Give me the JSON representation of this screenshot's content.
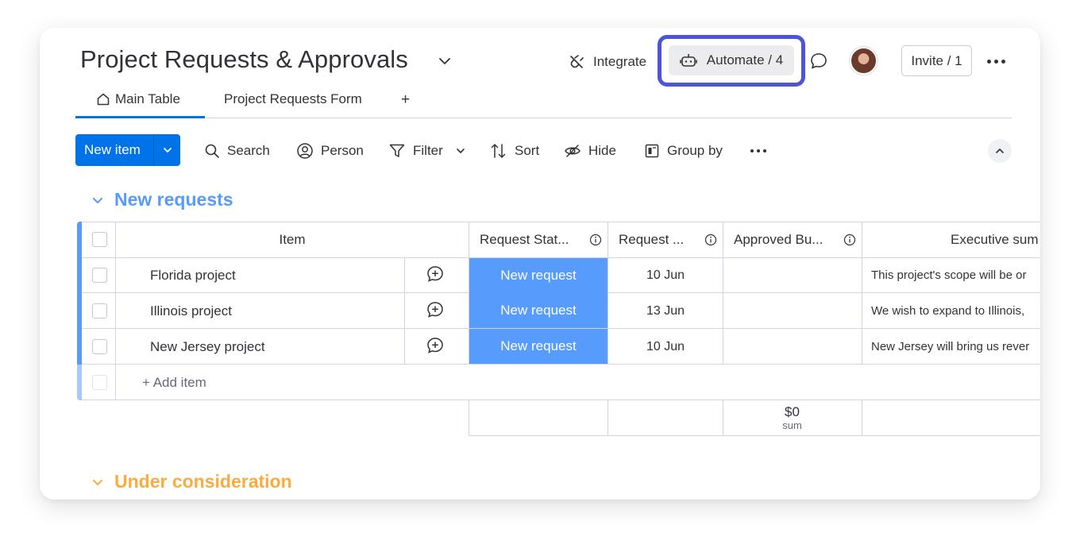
{
  "board": {
    "title": "Project Requests & Approvals",
    "integrate_label": "Integrate",
    "automate_label": "Automate / 4",
    "invite_label": "Invite / 1"
  },
  "tabs": [
    {
      "label": "Main Table",
      "icon": "home-icon",
      "active": true
    },
    {
      "label": "Project Requests Form",
      "active": false
    },
    {
      "label": "+",
      "active": false
    }
  ],
  "toolbar": {
    "new_item_label": "New item",
    "search_label": "Search",
    "person_label": "Person",
    "filter_label": "Filter",
    "sort_label": "Sort",
    "hide_label": "Hide",
    "group_by_label": "Group by"
  },
  "groups": [
    {
      "title": "New requests",
      "color": "#579bfc",
      "columns": [
        "Item",
        "Request Stat...",
        "Request ...",
        "Approved Bu...",
        "Executive sum"
      ],
      "rows": [
        {
          "item": "Florida project",
          "status": "New request",
          "date": "10 Jun",
          "budget": "",
          "summary": "This project's scope will be or"
        },
        {
          "item": "Illinois project",
          "status": "New request",
          "date": "13 Jun",
          "budget": "",
          "summary": "We wish to expand to Illinois,"
        },
        {
          "item": "New Jersey project",
          "status": "New request",
          "date": "10 Jun",
          "budget": "",
          "summary": "New Jersey will bring us rever"
        }
      ],
      "add_item_label": "+ Add item",
      "footer": {
        "budget_sum": "$0",
        "budget_sum_label": "sum"
      }
    },
    {
      "title": "Under consideration",
      "color": "#fdab3d"
    }
  ],
  "colors": {
    "accent": "#0073ea",
    "status_new_request": "#579bfc",
    "automate_highlight": "#4c55d6"
  }
}
